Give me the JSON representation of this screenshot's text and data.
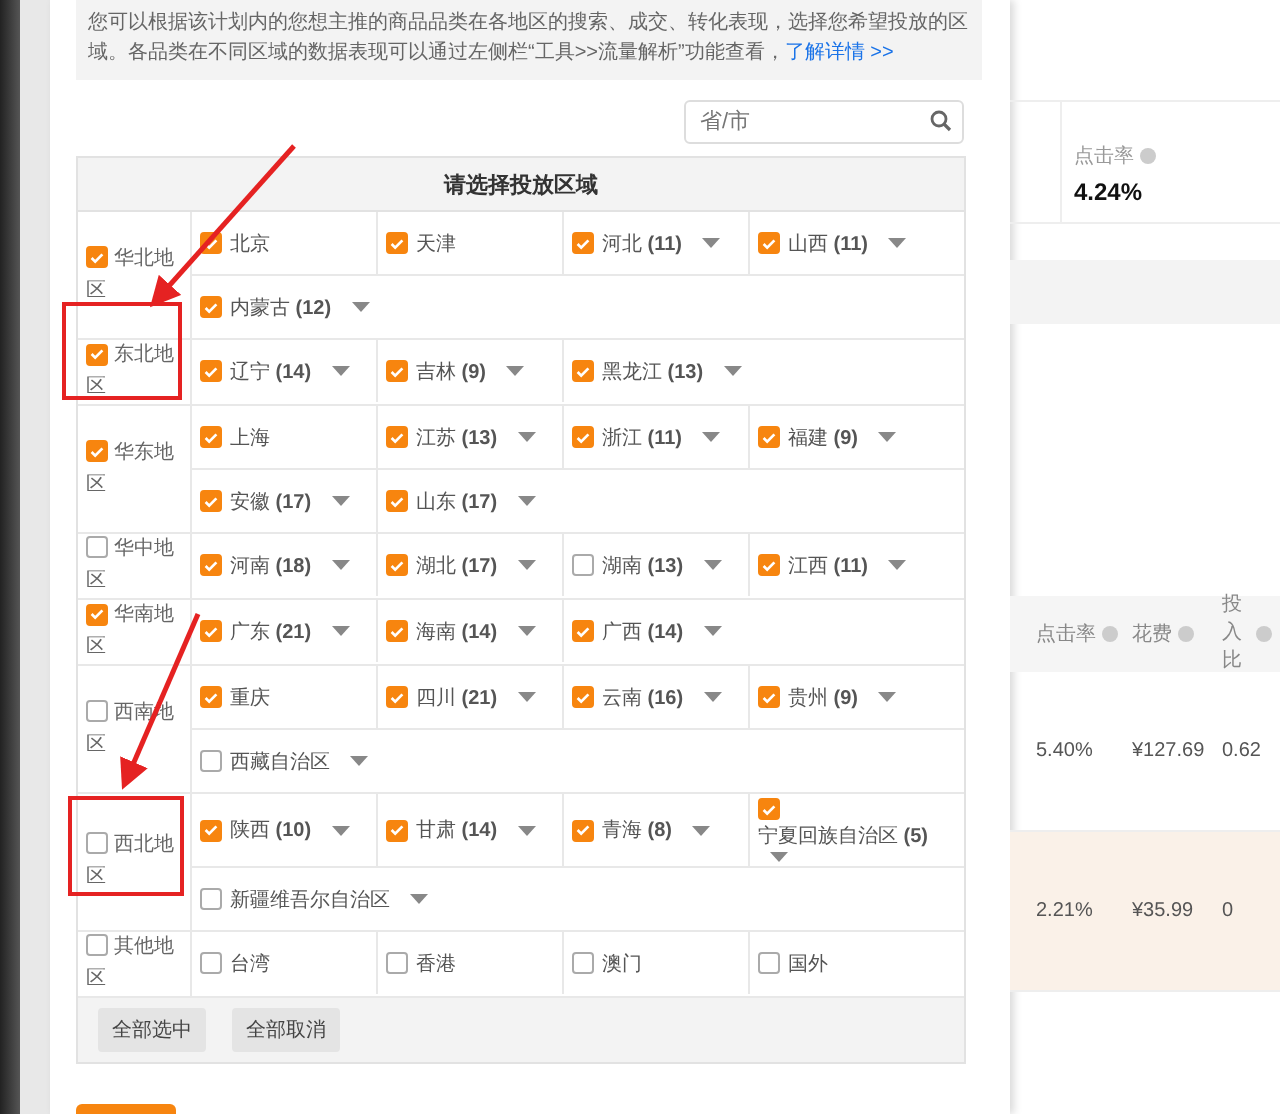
{
  "info": {
    "text": "您可以根据该计划内的您想主推的商品品类在各地区的搜索、成交、转化表现，选择您希望投放的区域。各品类在不同区域的数据表现可以通过左侧栏“工具>>流量解析”功能查看，",
    "link": "了解详情 >>"
  },
  "search": {
    "placeholder": "省/市"
  },
  "table": {
    "title": "请选择投放区域",
    "regions": [
      {
        "name": "华北地区",
        "checked": true,
        "rows": [
          [
            {
              "label": "北京",
              "checked": true,
              "expandable": false
            },
            {
              "label": "天津",
              "checked": true,
              "expandable": false
            },
            {
              "label": "河北 **(11)**",
              "checked": true,
              "expandable": true
            },
            {
              "label": "山西 **(11)**",
              "checked": true,
              "expandable": true
            }
          ],
          [
            {
              "label": "内蒙古 **(12)**",
              "checked": true,
              "expandable": true
            }
          ]
        ]
      },
      {
        "name": "东北地区",
        "checked": true,
        "rows": [
          [
            {
              "label": "辽宁 **(14)**",
              "checked": true,
              "expandable": true
            },
            {
              "label": "吉林 **(9)**",
              "checked": true,
              "expandable": true
            },
            {
              "label": "黑龙江 **(13)**",
              "checked": true,
              "expandable": true
            }
          ]
        ]
      },
      {
        "name": "华东地区",
        "checked": true,
        "rows": [
          [
            {
              "label": "上海",
              "checked": true,
              "expandable": false
            },
            {
              "label": "江苏 **(13)**",
              "checked": true,
              "expandable": true
            },
            {
              "label": "浙江 **(11)**",
              "checked": true,
              "expandable": true
            },
            {
              "label": "福建 **(9)**",
              "checked": true,
              "expandable": true
            }
          ],
          [
            {
              "label": "安徽 **(17)**",
              "checked": true,
              "expandable": true
            },
            {
              "label": "山东 **(17)**",
              "checked": true,
              "expandable": true
            }
          ]
        ]
      },
      {
        "name": "华中地区",
        "checked": false,
        "rows": [
          [
            {
              "label": "河南 **(18)**",
              "checked": true,
              "expandable": true
            },
            {
              "label": "湖北 **(17)**",
              "checked": true,
              "expandable": true
            },
            {
              "label": "湖南 **(13)**",
              "checked": false,
              "expandable": true
            },
            {
              "label": "江西 **(11)**",
              "checked": true,
              "expandable": true
            }
          ]
        ]
      },
      {
        "name": "华南地区",
        "checked": true,
        "rows": [
          [
            {
              "label": "广东 **(21)**",
              "checked": true,
              "expandable": true
            },
            {
              "label": "海南 **(14)**",
              "checked": true,
              "expandable": true
            },
            {
              "label": "广西 **(14)**",
              "checked": true,
              "expandable": true
            }
          ]
        ]
      },
      {
        "name": "西南地区",
        "checked": false,
        "rows": [
          [
            {
              "label": "重庆",
              "checked": true,
              "expandable": false
            },
            {
              "label": "四川 **(21)**",
              "checked": true,
              "expandable": true
            },
            {
              "label": "云南 **(16)**",
              "checked": true,
              "expandable": true
            },
            {
              "label": "贵州 **(9)**",
              "checked": true,
              "expandable": true
            }
          ],
          [
            {
              "label": "西藏自治区",
              "checked": false,
              "expandable": true
            }
          ]
        ]
      },
      {
        "name": "西北地区",
        "checked": false,
        "rows": [
          [
            {
              "label": "陕西 **(10)**",
              "checked": true,
              "expandable": true
            },
            {
              "label": "甘肃 **(14)**",
              "checked": true,
              "expandable": true
            },
            {
              "label": "青海 **(8)**",
              "checked": true,
              "expandable": true
            },
            {
              "label": "宁夏回族自治区 **(5)**",
              "checked": true,
              "expandable": true
            }
          ],
          [
            {
              "label": "新疆维吾尔自治区",
              "checked": false,
              "expandable": true
            }
          ]
        ]
      },
      {
        "name": "其他地区",
        "checked": false,
        "rows": [
          [
            {
              "label": "台湾",
              "checked": false,
              "expandable": false
            },
            {
              "label": "香港",
              "checked": false,
              "expandable": false
            },
            {
              "label": "澳门",
              "checked": false,
              "expandable": false
            },
            {
              "label": "国外",
              "checked": false,
              "expandable": false
            }
          ]
        ]
      }
    ],
    "buttons": [
      "全部选中",
      "全部取消"
    ]
  },
  "background": {
    "stat": {
      "label": "点击率",
      "value": "4.24%"
    },
    "columns": [
      "点击率",
      "花费",
      "投入比"
    ],
    "rows": [
      {
        "highlighted": false,
        "cells": [
          "5.40%",
          "¥127.69",
          "0.62"
        ]
      },
      {
        "highlighted": true,
        "cells": [
          "2.21%",
          "¥35.99",
          "0"
        ]
      }
    ]
  }
}
